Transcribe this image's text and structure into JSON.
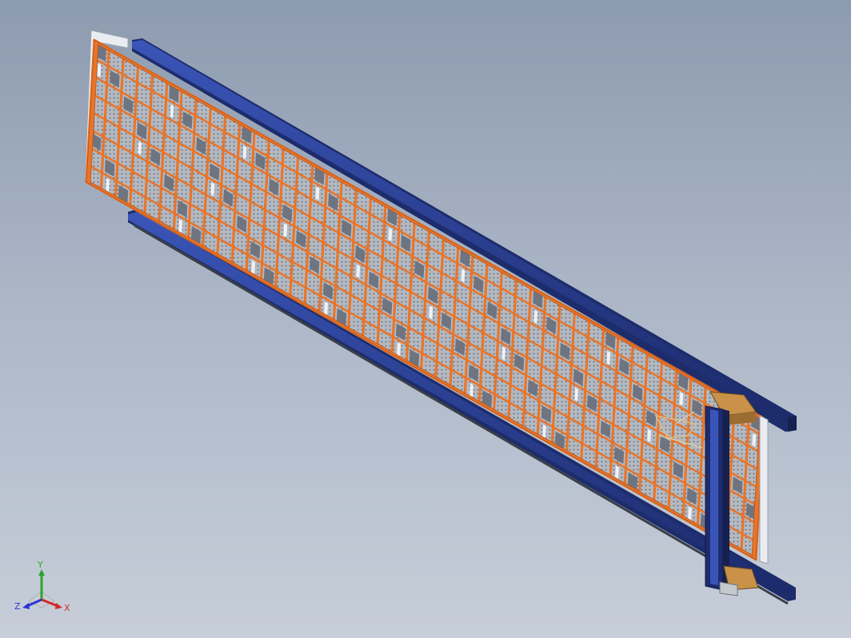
{
  "viewport": {
    "background_top": "#8d9bb0",
    "background_bottom": "#c7ced9",
    "colors": {
      "frame_orange": "#e8752a",
      "frame_orange_dark": "#b9541a",
      "rail_blue": "#2b3f8f",
      "rail_blue_dark": "#18265e",
      "panel_grey": "#b7bcc3",
      "panel_dark": "#6e7480",
      "carriage_tan": "#c99248",
      "side_white": "#e9edf2"
    }
  },
  "triad": {
    "x_label": "X",
    "y_label": "Y",
    "z_label": "Z",
    "x_color": "#d42a2a",
    "y_color": "#2aa52a",
    "z_color": "#2a35d4"
  }
}
